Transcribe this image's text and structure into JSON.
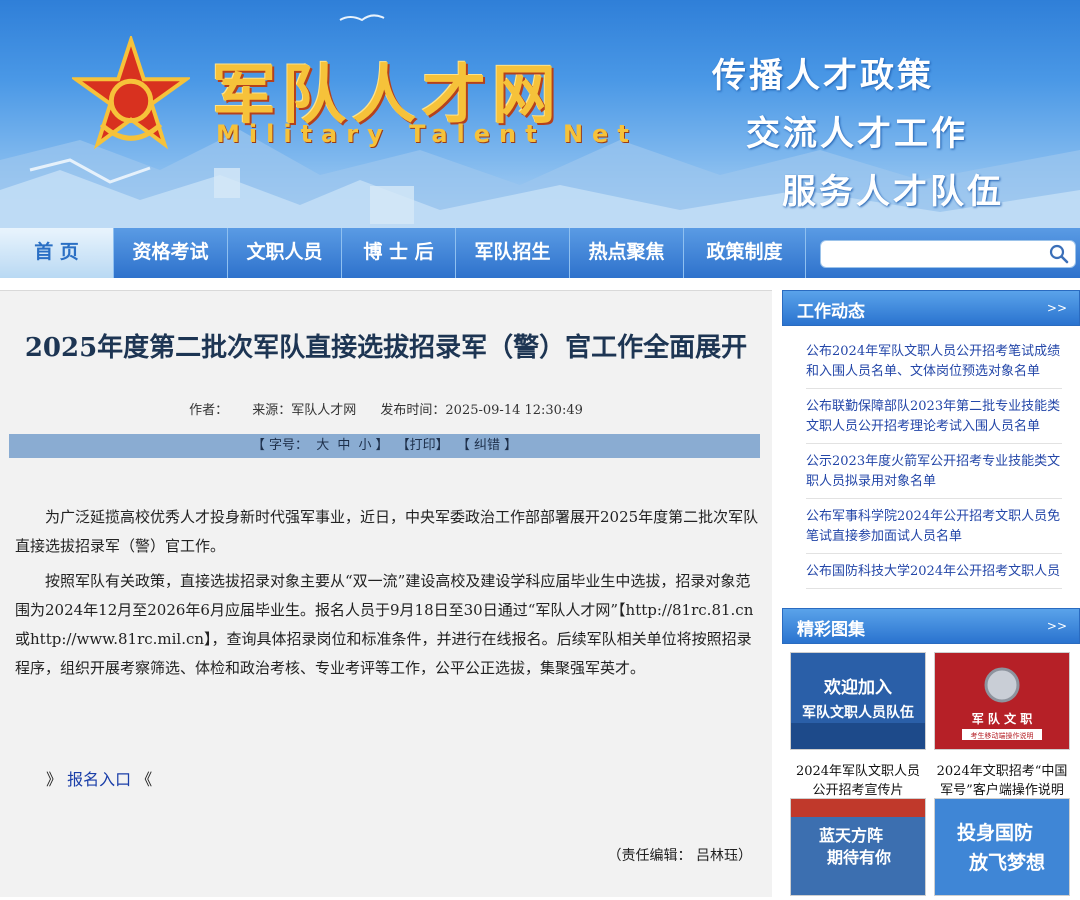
{
  "header": {
    "site_name_cn": "军队人才网",
    "site_name_en": "Military Talent Net",
    "slogans": [
      "传播人才政策",
      "交流人才工作",
      "服务人才队伍"
    ]
  },
  "nav": {
    "items": [
      {
        "label": "首 页",
        "active": true
      },
      {
        "label": "资格考试"
      },
      {
        "label": "文职人员"
      },
      {
        "label": "博 士 后"
      },
      {
        "label": "军队招生"
      },
      {
        "label": "热点聚焦"
      },
      {
        "label": "政策制度"
      }
    ],
    "search_placeholder": ""
  },
  "article": {
    "title": "2025年度第二批次军队直接选拔招录军（警）官工作全面展开",
    "author_label": "作者：",
    "source_label": "来源：军队人才网",
    "publish_label": "发布时间：2025-09-14 12:30:49",
    "toolbar": {
      "font_size_open": "【 字号：",
      "size_large": "大",
      "size_medium": "中",
      "size_small": "小",
      "font_size_close": "】",
      "print": "【打印】",
      "report_error": "【 纠错 】"
    },
    "paragraphs": [
      "为广泛延揽高校优秀人才投身新时代强军事业，近日，中央军委政治工作部部署展开2025年度第二批次军队直接选拔招录军（警）官工作。",
      "按照军队有关政策，直接选拔招录对象主要从“双一流”建设高校及建设学科应届毕业生中选拔，招录对象范围为2024年12月至2026年6月应届毕业生。报名人员于9月18日至30日通过“军队人才网”【http://81rc.81.cn或http://www.81rc.mil.cn】，查询具体招录岗位和标准条件，并进行在线报名。后续军队相关单位将按照招录程序，组织开展考察筛选、体检和政治考核、专业考评等工作，公平公正选拔，集聚强军英才。"
    ],
    "signup_prefix": "》",
    "signup_link": "报名入口",
    "signup_suffix": "《",
    "editor": "（责任编辑： 吕林珏）"
  },
  "sidebar": {
    "news_title": "工作动态",
    "news_more": ">>",
    "news": [
      "公布2024年军队文职人员公开招考笔试成绩和入围人员名单、文体岗位预选对象名单",
      "公布联勤保障部队2023年第二批专业技能类文职人员公开招考理论考试入围人员名单",
      "公示2023年度火箭军公开招考专业技能类文职人员拟录用对象名单",
      "公布军事科学院2024年公开招考文职人员免笔试直接参加面试人员名单",
      "公布国防科技大学2024年公开招考文职人员"
    ],
    "gallery_title": "精彩图集",
    "gallery_more": ">>",
    "gallery": [
      {
        "img_text_1": "欢迎加入",
        "img_text_2": "军队文职人员队伍",
        "caption": "2024年军队文职人员公开招考宣传片"
      },
      {
        "img_text_1": "军 队 文 职",
        "img_text_2": "考生移动端操作说明",
        "caption": "2024年文职招考“中国军号”客户端操作说明"
      },
      {
        "img_text_1": "蓝天方阵",
        "img_text_2": "期待有你",
        "caption": ""
      },
      {
        "img_text_1": "投身国防",
        "img_text_2": "放飞梦想",
        "caption": ""
      }
    ]
  },
  "colors": {
    "nav_blue": "#2e72cc",
    "title_navy": "#1d3553",
    "link_blue": "#2346a8",
    "gold": "#f6c23a",
    "star_red": "#d8311f"
  }
}
